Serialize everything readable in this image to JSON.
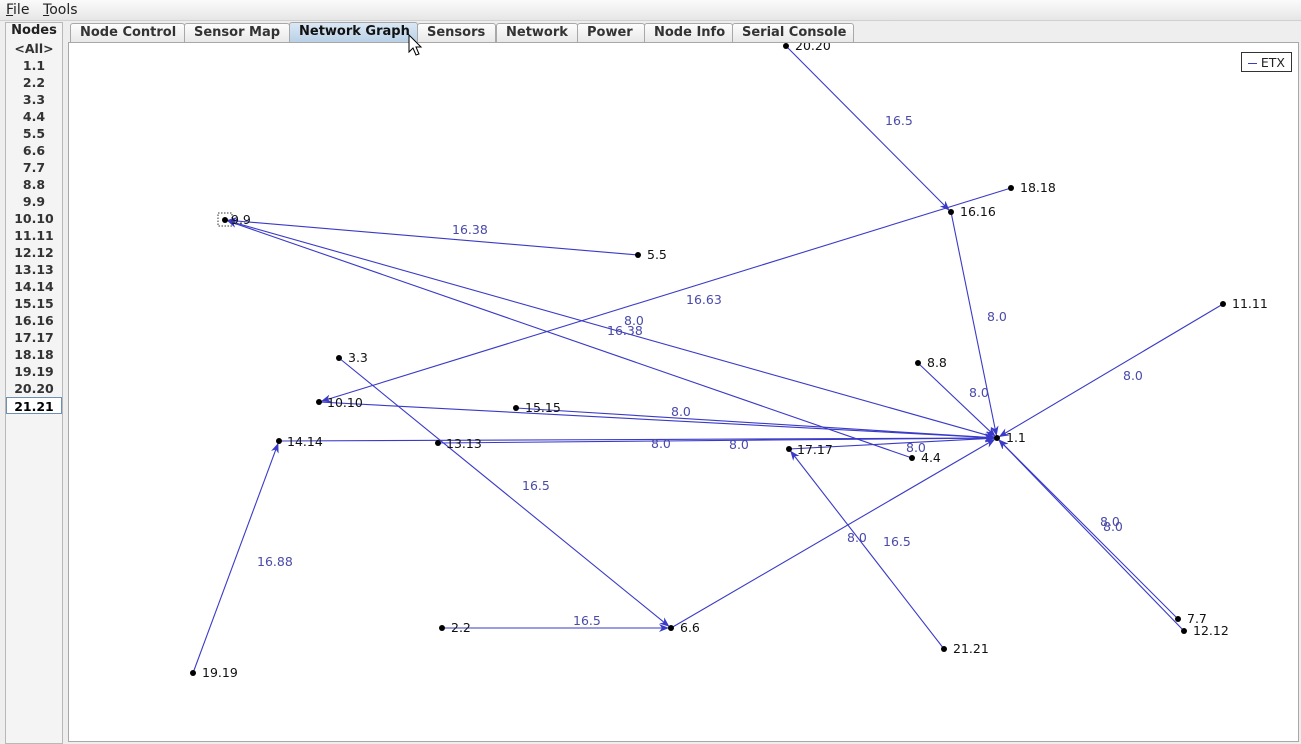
{
  "menu": [
    {
      "first": "F",
      "rest": "ile"
    },
    {
      "first": "T",
      "rest": "ools"
    }
  ],
  "nodes_panel": {
    "title": "Nodes",
    "items": [
      "<All>",
      "1.1",
      "2.2",
      "3.3",
      "4.4",
      "5.5",
      "6.6",
      "7.7",
      "8.8",
      "9.9",
      "10.10",
      "11.11",
      "12.12",
      "13.13",
      "14.14",
      "15.15",
      "16.16",
      "17.17",
      "18.18",
      "19.19",
      "20.20",
      "21.21"
    ],
    "selected": "21.21"
  },
  "tabs": [
    "Node Control",
    "Sensor Map",
    "Network Graph",
    "Sensors",
    "Network",
    "Power",
    "Node Info",
    "Serial Console"
  ],
  "active_tab": "Network Graph",
  "legend": {
    "label": "ETX"
  },
  "colors": {
    "edge": "#3a3ac8",
    "edge_label": "#4a4aaa",
    "node": "#000000",
    "active_tab": "#b8cfe6"
  },
  "graph": {
    "nodes": [
      {
        "id": "1.1"
      },
      {
        "id": "2.2"
      },
      {
        "id": "3.3"
      },
      {
        "id": "4.4"
      },
      {
        "id": "5.5"
      },
      {
        "id": "6.6"
      },
      {
        "id": "7.7"
      },
      {
        "id": "8.8"
      },
      {
        "id": "9.9"
      },
      {
        "id": "10.10"
      },
      {
        "id": "11.11"
      },
      {
        "id": "12.12"
      },
      {
        "id": "13.13"
      },
      {
        "id": "14.14"
      },
      {
        "id": "15.15"
      },
      {
        "id": "16.16"
      },
      {
        "id": "17.17"
      },
      {
        "id": "18.18"
      },
      {
        "id": "19.19"
      },
      {
        "id": "20.20"
      },
      {
        "id": "21.21"
      }
    ],
    "edges": [
      {
        "from": "20.20",
        "to": "16.16",
        "etx": "16.5"
      },
      {
        "from": "5.5",
        "to": "9.9",
        "etx": "16.38"
      },
      {
        "from": "4.4",
        "to": "9.9",
        "etx": "16.38"
      },
      {
        "from": "9.9",
        "to": "1.1",
        "etx": "8.0"
      },
      {
        "from": "18.18",
        "to": "10.10",
        "etx": "16.63"
      },
      {
        "from": "16.16",
        "to": "1.1",
        "etx": "8.0"
      },
      {
        "from": "11.11",
        "to": "1.1",
        "etx": "8.0"
      },
      {
        "from": "8.8",
        "to": "1.1",
        "etx": "8.0"
      },
      {
        "from": "10.10",
        "to": "1.1",
        "etx": "8.0"
      },
      {
        "from": "15.15",
        "to": "1.1",
        "etx": ""
      },
      {
        "from": "14.14",
        "to": "1.1",
        "etx": "8.0"
      },
      {
        "from": "13.13",
        "to": "1.1",
        "etx": "8.0"
      },
      {
        "from": "17.17",
        "to": "1.1",
        "etx": "8.0"
      },
      {
        "from": "3.3",
        "to": "6.6",
        "etx": "16.5"
      },
      {
        "from": "6.6",
        "to": "1.1",
        "etx": "8.0"
      },
      {
        "from": "21.21",
        "to": "17.17",
        "etx": "16.5"
      },
      {
        "from": "7.7",
        "to": "1.1",
        "etx": "8.0"
      },
      {
        "from": "12.12",
        "to": "1.1",
        "etx": "8.0"
      },
      {
        "from": "2.2",
        "to": "6.6",
        "etx": "16.5"
      },
      {
        "from": "19.19",
        "to": "14.14",
        "etx": "16.88"
      }
    ]
  }
}
